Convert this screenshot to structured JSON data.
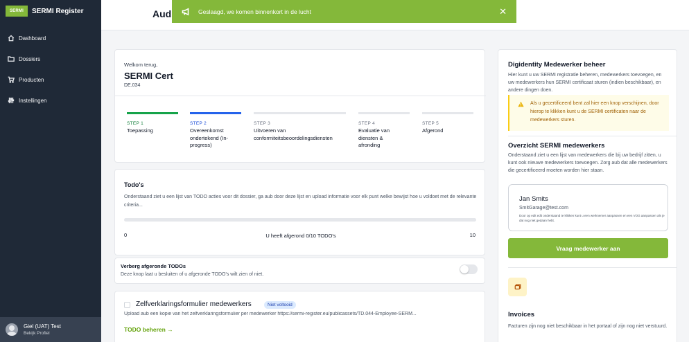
{
  "app": {
    "brand_logo_text": "SERMI",
    "brand_name": "SERMI Register"
  },
  "sidebar": {
    "items": [
      {
        "label": "Dashboard",
        "icon": "home-icon"
      },
      {
        "label": "Dossiers",
        "icon": "folder-icon"
      },
      {
        "label": "Producten",
        "icon": "cart-icon"
      },
      {
        "label": "Instellingen",
        "icon": "sliders-icon"
      }
    ],
    "user": {
      "name": "Giel (UAT) Test",
      "sub": "Bekijk Profiel"
    }
  },
  "header": {
    "title": "Audi"
  },
  "toast": {
    "message": "Geslaagd, we komen binnenkort in de lucht",
    "icon": "megaphone-icon",
    "close_icon": "close-icon"
  },
  "welcome": {
    "greeting": "Welkom terug,",
    "title": "SERMI Cert",
    "code": "DE.034",
    "steps": [
      {
        "num": "STEP 1",
        "label": "Toepassing",
        "status": "done"
      },
      {
        "num": "STEP 2",
        "label": "Overeenkomst ondertekend (In-progress)",
        "status": "active"
      },
      {
        "num": "STEP 3",
        "label": "Uitvoeren van conformiteitsbeoordelingsdiensten",
        "status": "todo"
      },
      {
        "num": "STEP 4",
        "label": "Evaluatie van diensten & afronding",
        "status": "todo"
      },
      {
        "num": "STEP 5",
        "label": "Afgerond",
        "status": "todo"
      }
    ]
  },
  "todos": {
    "title": "Todo's",
    "description": "Onderstaand ziet u een lijst van TODO acties voor dit dossier, ga aub door deze lijst en upload informatie voor elk punt welke bewijst hoe u voldoet met de relevante criteria...",
    "progress_min": "0",
    "progress_max": "10",
    "progress_text": "U heeft afgerond 0/10 TODO's",
    "progress_fraction": 0
  },
  "toggle": {
    "title": "Verberg afgeronde TODOs",
    "description": "Deze knop laat u besluiten of u afgeronde TODO's wilt zien of niet.",
    "enabled": false
  },
  "todo_item": {
    "title": "Zelfverklaringsformulier medewerkers",
    "badge": "Niet voltooid",
    "description": "Upload aub een kopie van het zelfverklaringsformulier per medewerker https://sermi-register.eu/publicassets/TD.044-Employee-SERM...",
    "link": "TODO beheren →"
  },
  "right": {
    "digi_title": "Digidentity Medewerker beheer",
    "digi_text": "Hier kunt u uw SERMI registratie beheren, medewerkers toevoegen, en uw medewerkers hun SERMI certificaat sturen (indien beschikbaar), en andere dingen doen.",
    "warning": "Als u gecertificeerd bent zal hier een knop verschijnen, door hierop te klikken kunt u de SERMI certificaten naar de medewerkers sturen.",
    "overview_title": "Overzicht SERMI medewerkers",
    "overview_text": "Onderstaand ziet u een lijst van medewerkers die bij uw bedrijf zitten, u kunt ook nieuwe medewerkers toevoegen. Zorg aub dat alle medewerkers die gecertificeerd moeten worden hier staan.",
    "employee": {
      "name": "Jan Smits",
      "email": "SmitGarage@test.com",
      "note": "Door op edit edit onderstaand te klikken kunt u een werknemer aanpassen en een VOG aanpassen als je dat nog niet gedaan hebt."
    },
    "request_button": "Vraag medewerker aan",
    "invoices_title": "Invoices",
    "invoices_text": "Facturen zijn nog niet beschikbaar in het portaal of zijn nog niet verstuurd."
  },
  "colors": {
    "brand": "#84b83a",
    "sidebar": "#1f2937",
    "step_done": "#16a34a",
    "step_active": "#2563eb"
  }
}
